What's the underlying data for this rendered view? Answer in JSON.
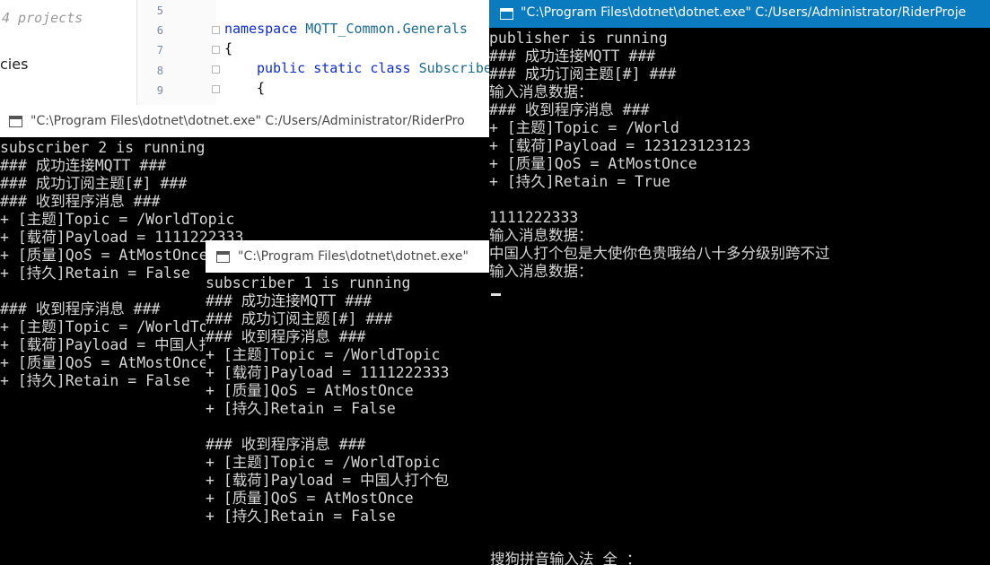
{
  "ide": {
    "project_count": "4 projects",
    "tree_item": "cies",
    "line_numbers": [
      "5",
      "6",
      "7",
      "8",
      "9"
    ],
    "code": {
      "kw_namespace": "namespace",
      "ns_name": " MQTT_Common.Generals",
      "brace_open": "{",
      "kw_public_static_class": "public static class",
      "class_name": " Subscribe",
      "brace_inner": "{"
    }
  },
  "windows": {
    "subscriber2": {
      "title": "\"C:\\Program Files\\dotnet\\dotnet.exe\" C:/Users/Administrator/RiderPro",
      "lines": [
        "subscriber 2 is running",
        "### 成功连接MQTT ###",
        "### 成功订阅主题[#] ###",
        "### 收到程序消息 ###",
        "+ [主题]Topic = /WorldTopic",
        "+ [载荷]Payload = 1111222333",
        "+ [质量]QoS = AtMostOnce",
        "+ [持久]Retain = False",
        "",
        "### 收到程序消息 ###",
        "+ [主题]Topic = /WorldTopic",
        "+ [载荷]Payload = 中国人打个包是大使你色贵哦给八十多分级别跨不过",
        "+ [质量]QoS = AtMostOnce",
        "+ [持久]Retain = False"
      ]
    },
    "subscriber1": {
      "title": "\"C:\\Program Files\\dotnet\\dotnet.exe\"",
      "lines": [
        "subscriber 1 is running",
        "### 成功连接MQTT ###",
        "### 成功订阅主题[#] ###",
        "### 收到程序消息 ###",
        "+ [主题]Topic = /WorldTopic",
        "+ [载荷]Payload = 1111222333",
        "+ [质量]QoS = AtMostOnce",
        "+ [持久]Retain = False",
        "",
        "### 收到程序消息 ###",
        "+ [主题]Topic = /WorldTopic",
        "+ [载荷]Payload = 中国人打个包",
        "+ [质量]QoS = AtMostOnce",
        "+ [持久]Retain = False"
      ]
    },
    "publisher": {
      "title": "\"C:\\Program Files\\dotnet\\dotnet.exe\" C:/Users/Administrator/RiderProje",
      "lines": [
        "publisher is running",
        "### 成功连接MQTT ###",
        "### 成功订阅主题[#] ###",
        "输入消息数据：",
        "### 收到程序消息 ###",
        "+ [主题]Topic = /World",
        "+ [载荷]Payload = 123123123123",
        "+ [质量]QoS = AtMostOnce",
        "+ [持久]Retain = True",
        "",
        "1111222333",
        "输入消息数据：",
        "中国人打个包是大使你色贵哦给八十多分级别跨不过",
        "输入消息数据："
      ],
      "ime_status": "搜狗拼音输入法 全 ："
    }
  },
  "colors": {
    "console_bg": "#000000",
    "console_text": "#d6d6d6",
    "titlebar_active": "#0a7bbf",
    "titlebar_inactive": "#ffffff"
  }
}
